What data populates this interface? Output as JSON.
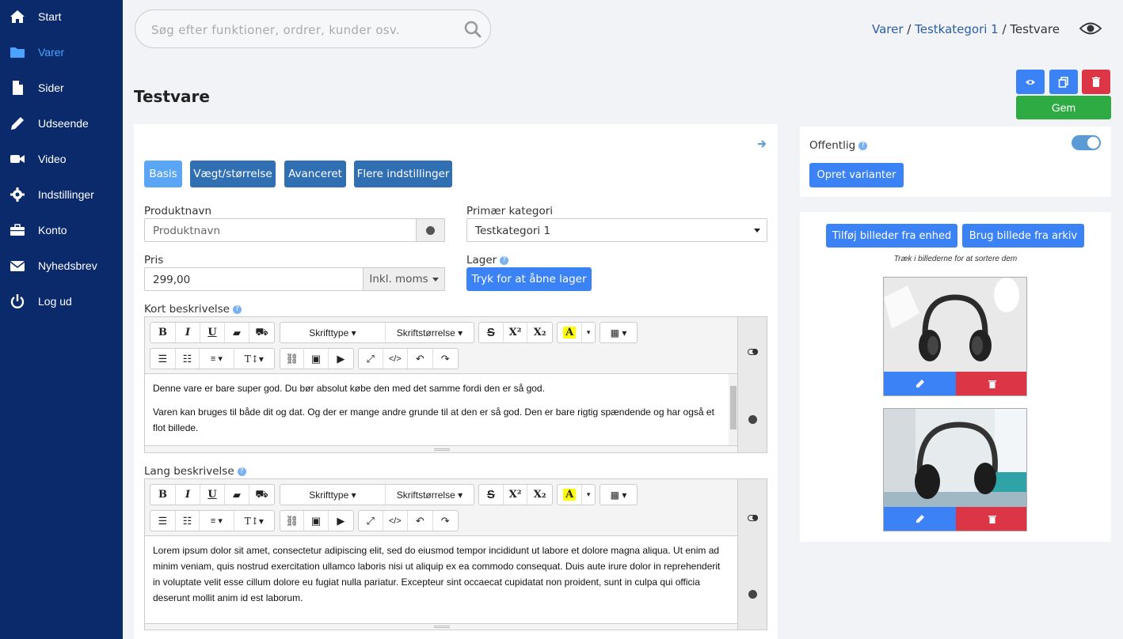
{
  "sidebar": {
    "items": [
      {
        "label": "Start",
        "icon": "home-icon",
        "active": false
      },
      {
        "label": "Varer",
        "icon": "folder-icon",
        "active": true
      },
      {
        "label": "Sider",
        "icon": "file-icon",
        "active": false
      },
      {
        "label": "Udseende",
        "icon": "pencil-icon",
        "active": false
      },
      {
        "label": "Video",
        "icon": "video-icon",
        "active": false
      },
      {
        "label": "Indstillinger",
        "icon": "gear-icon",
        "active": false
      },
      {
        "label": "Konto",
        "icon": "briefcase-icon",
        "active": false
      },
      {
        "label": "Nyhedsbrev",
        "icon": "envelope-icon",
        "active": false
      },
      {
        "label": "Log ud",
        "icon": "power-icon",
        "active": false
      }
    ]
  },
  "search": {
    "placeholder": "Søg efter funktioner, ordrer, kunder osv."
  },
  "breadcrumb": {
    "part1": "Varer",
    "sep1": " / ",
    "part2": "Testkategori 1",
    "sep2": " / ",
    "current": "Testvare"
  },
  "page": {
    "title": "Testvare",
    "save_label": "Gem"
  },
  "tabs": [
    "Basis",
    "Vægt/størrelse",
    "Avanceret",
    "Flere indstillinger"
  ],
  "form": {
    "product_name_label": "Produktnavn",
    "product_name_placeholder": "Produktnavn",
    "primary_category_label": "Primær kategori",
    "primary_category_value": "Testkategori 1",
    "price_label": "Pris",
    "price_value": "299,00",
    "price_tax_option": "Inkl. moms",
    "stock_label": "Lager",
    "stock_button": "Tryk for at åbne lager",
    "short_desc_label": "Kort beskrivelse",
    "long_desc_label": "Lang beskrivelse"
  },
  "editor_toolbar": {
    "font_label": "Skrifttype",
    "fontsize_label": "Skriftstørrelse"
  },
  "short_description": {
    "p1": "Denne vare er bare super god. Du bør absolut købe den med det samme fordi den er så god.",
    "p2": "Varen kan bruges til både dit og dat. Og der er mange andre grunde til at den er så god. Den er bare rigtig spændende og har også et flot billede."
  },
  "long_description": {
    "p1": "Lorem ipsum dolor sit amet, consectetur adipiscing elit, sed do eiusmod tempor incididunt ut labore et dolore magna aliqua. Ut enim ad minim veniam, quis nostrud exercitation ullamco laboris nisi ut aliquip ex ea commodo consequat. Duis aute irure dolor in reprehenderit in voluptate velit esse cillum dolore eu fugiat nulla pariatur. Excepteur sint occaecat cupidatat non proident, sunt in culpa qui officia deserunt mollit anim id est laborum."
  },
  "right_panel": {
    "public_label": "Offentlig",
    "public_on": true,
    "create_variants": "Opret varianter",
    "add_images_device": "Tilføj billeder fra enhed",
    "use_archive_image": "Brug billede fra arkiv",
    "sort_hint": "Træk i billederne for at sortere dem"
  },
  "colors": {
    "sidebar": "#0b2a6b",
    "primary": "#3b82f6",
    "tab": "#2f6fb2",
    "danger": "#dc3545",
    "success": "#2eab43"
  }
}
